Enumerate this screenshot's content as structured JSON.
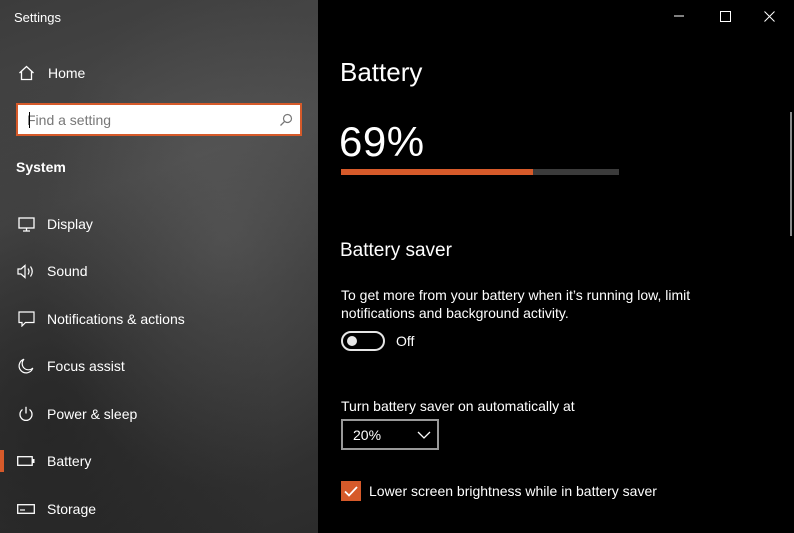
{
  "window": {
    "title": "Settings"
  },
  "sidebar": {
    "home_label": "Home",
    "search": {
      "placeholder": "Find a setting"
    },
    "section_title": "System",
    "items": [
      {
        "label": "Display",
        "icon": "monitor-icon",
        "active": false
      },
      {
        "label": "Sound",
        "icon": "speaker-icon",
        "active": false
      },
      {
        "label": "Notifications & actions",
        "icon": "notification-icon",
        "active": false
      },
      {
        "label": "Focus assist",
        "icon": "moon-icon",
        "active": false
      },
      {
        "label": "Power & sleep",
        "icon": "power-icon",
        "active": false
      },
      {
        "label": "Battery",
        "icon": "battery-icon",
        "active": true
      },
      {
        "label": "Storage",
        "icon": "storage-icon",
        "active": false
      }
    ]
  },
  "main": {
    "title": "Battery",
    "charge_text": "69%",
    "charge_level": 0.69,
    "battery_saver": {
      "heading": "Battery saver",
      "description": "To get more from your battery when it’s running low, limit notifications and background activity.",
      "toggle_state": "Off",
      "auto_label": "Turn battery saver on automatically at",
      "auto_value": "20%",
      "brightness_label": "Lower screen brightness while in battery saver",
      "brightness_checked": true
    }
  },
  "colors": {
    "accent": "#d65a2a",
    "main_bg": "#000000",
    "bar_track": "#3b3b3b"
  }
}
